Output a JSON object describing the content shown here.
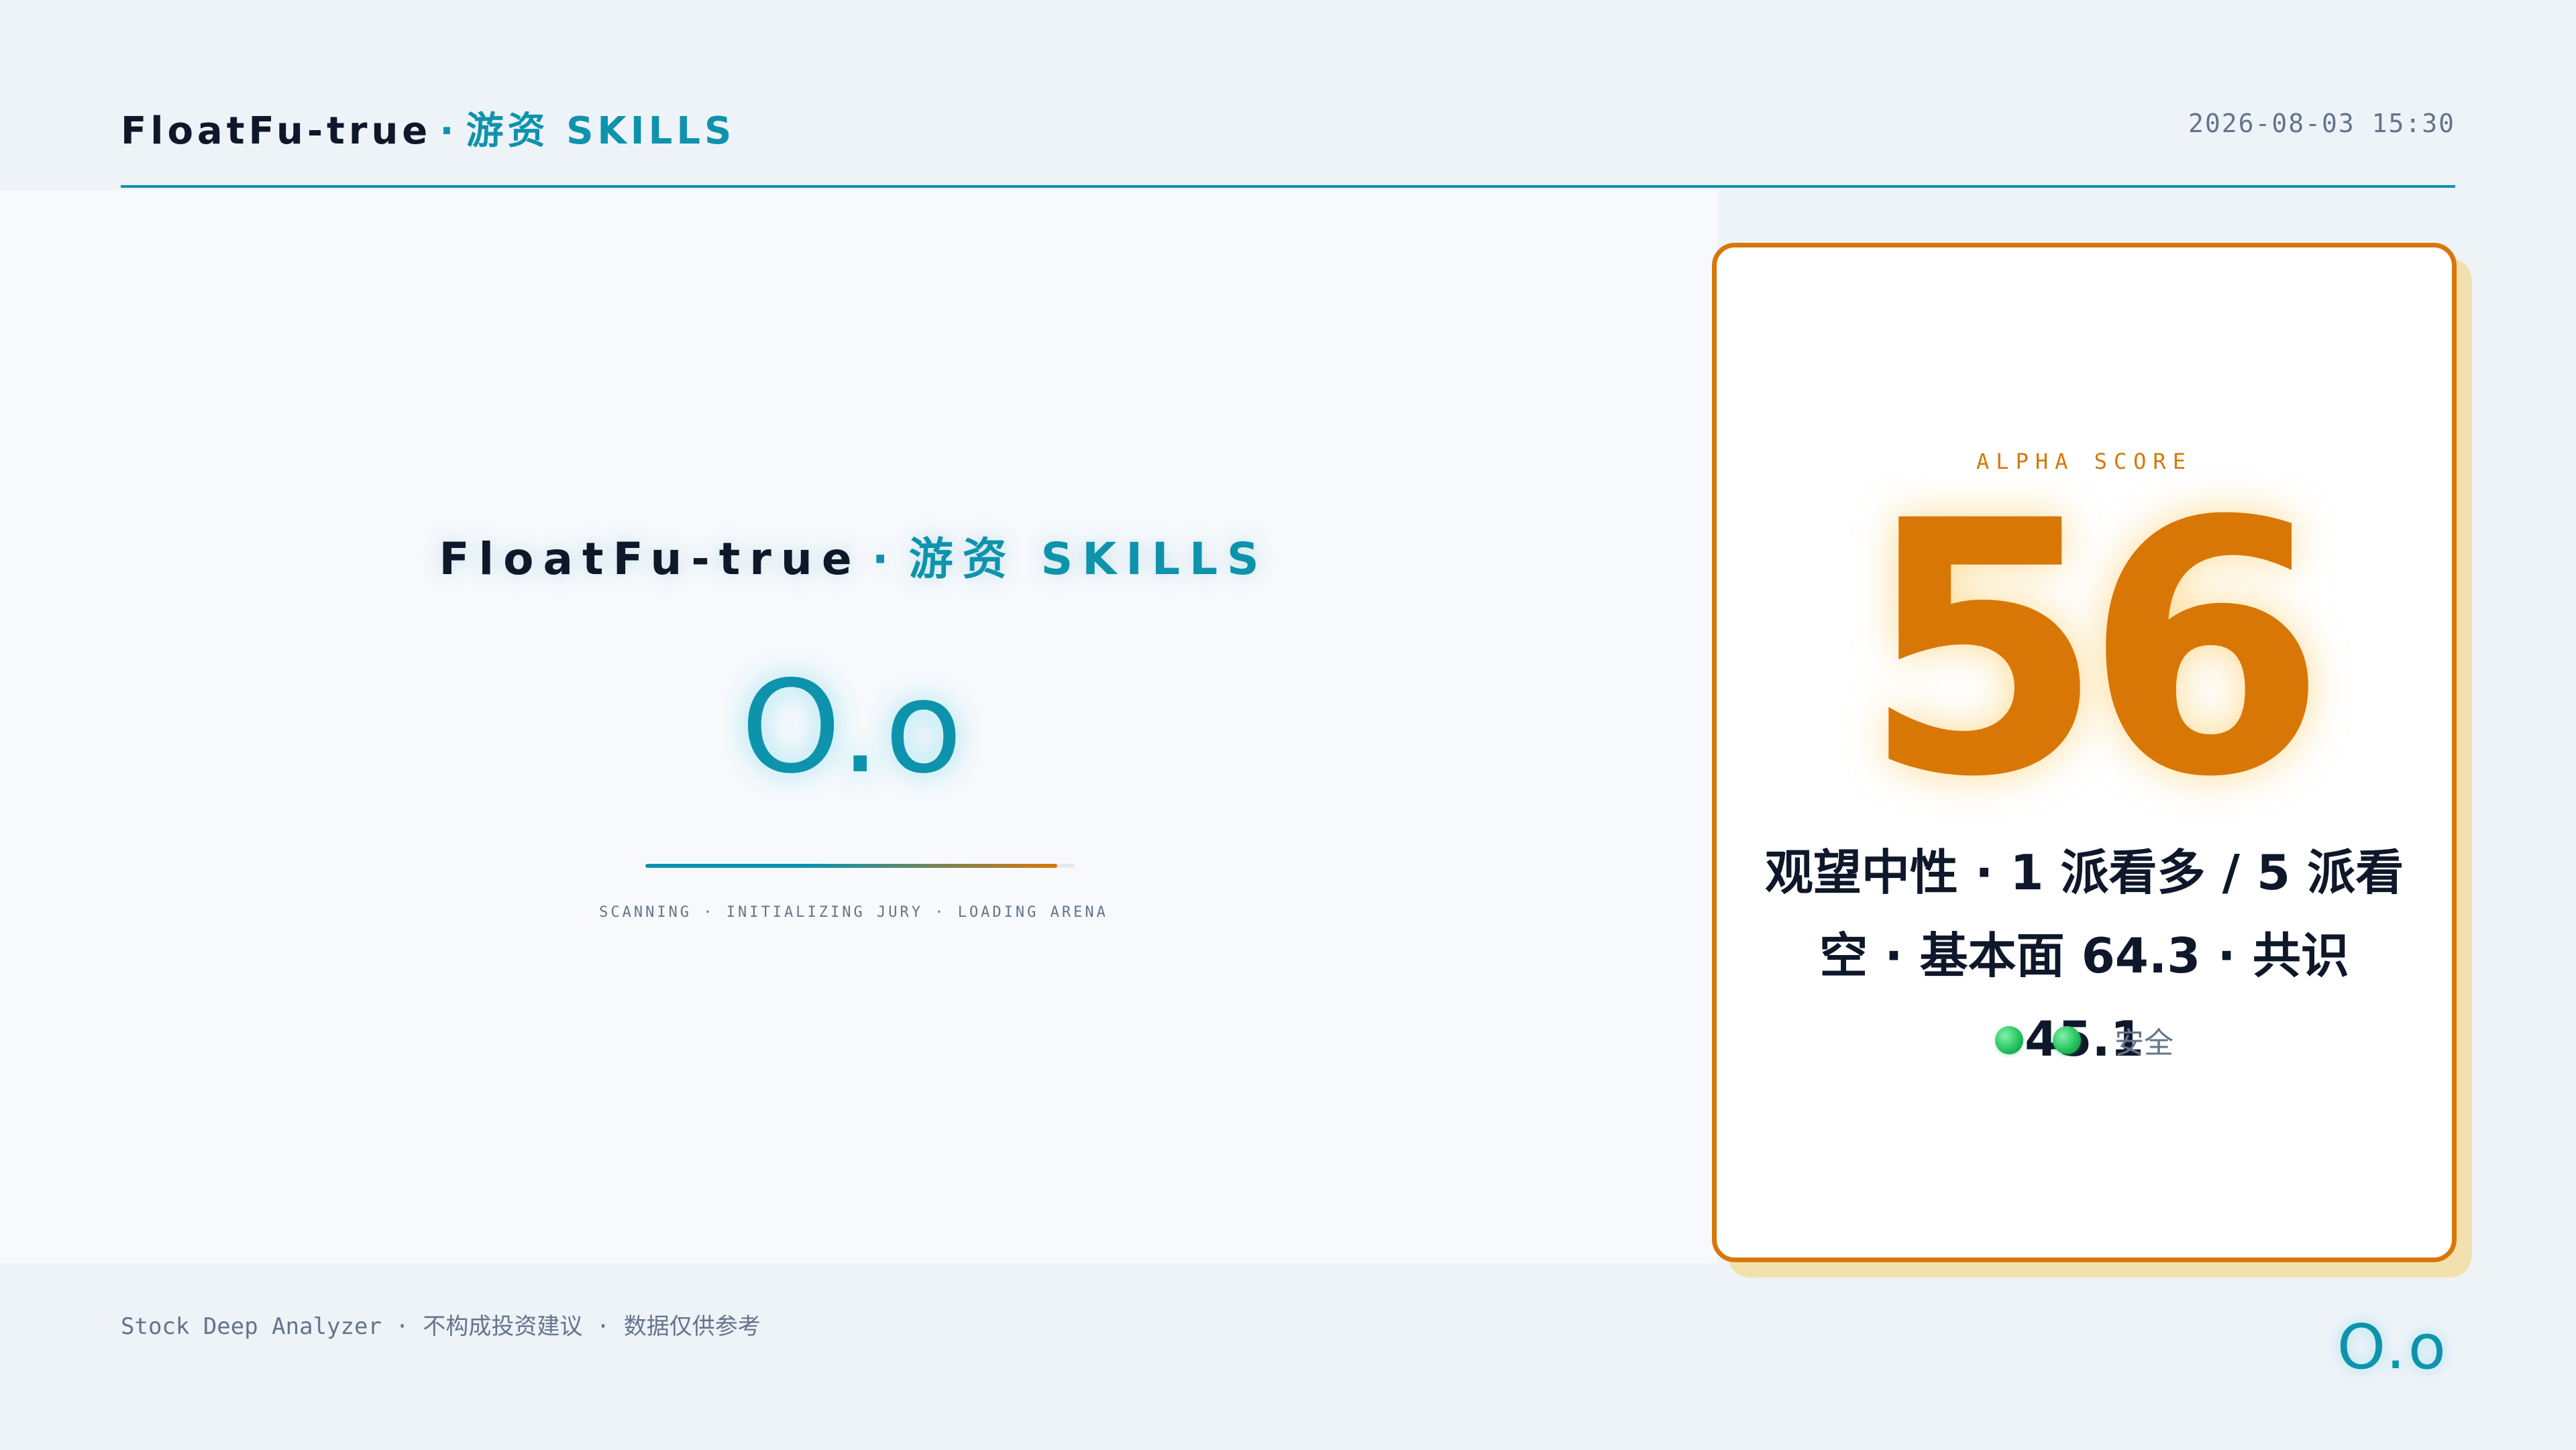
{
  "header": {
    "brand_name": "FloatFu-true",
    "brand_separator": "·",
    "brand_suffix": "游资 SKILLS",
    "timestamp": "2026-08-03 15:30"
  },
  "loader": {
    "brand_name": "FloatFu-true",
    "brand_separator": "·",
    "brand_suffix": "游资 SKILLS",
    "logo": "O.o",
    "progress": 0.96,
    "status_text": "SCANNING · INITIALIZING JURY · LOADING ARENA"
  },
  "score_card": {
    "label": "ALPHA SCORE",
    "score": "56",
    "verdict": "观望中性 · 1 派看多 / 5 派看空 · 基本面 64.3 · 共识 45.1",
    "indicators": [
      {
        "icon": "green-dot-icon",
        "color": "#22c55e"
      },
      {
        "icon": "green-dot-icon",
        "color": "#22c55e"
      }
    ],
    "status_label": "安全"
  },
  "footer": {
    "disclaimer": "Stock Deep Analyzer · 不构成投资建议 · 数据仅供参考",
    "logo": "O.o"
  },
  "colors": {
    "accent_teal": "#0e93ad",
    "accent_orange": "#d97706",
    "card_shadow": "#f3e1ad",
    "text_dark": "#0f172a",
    "text_muted": "#64748b"
  }
}
